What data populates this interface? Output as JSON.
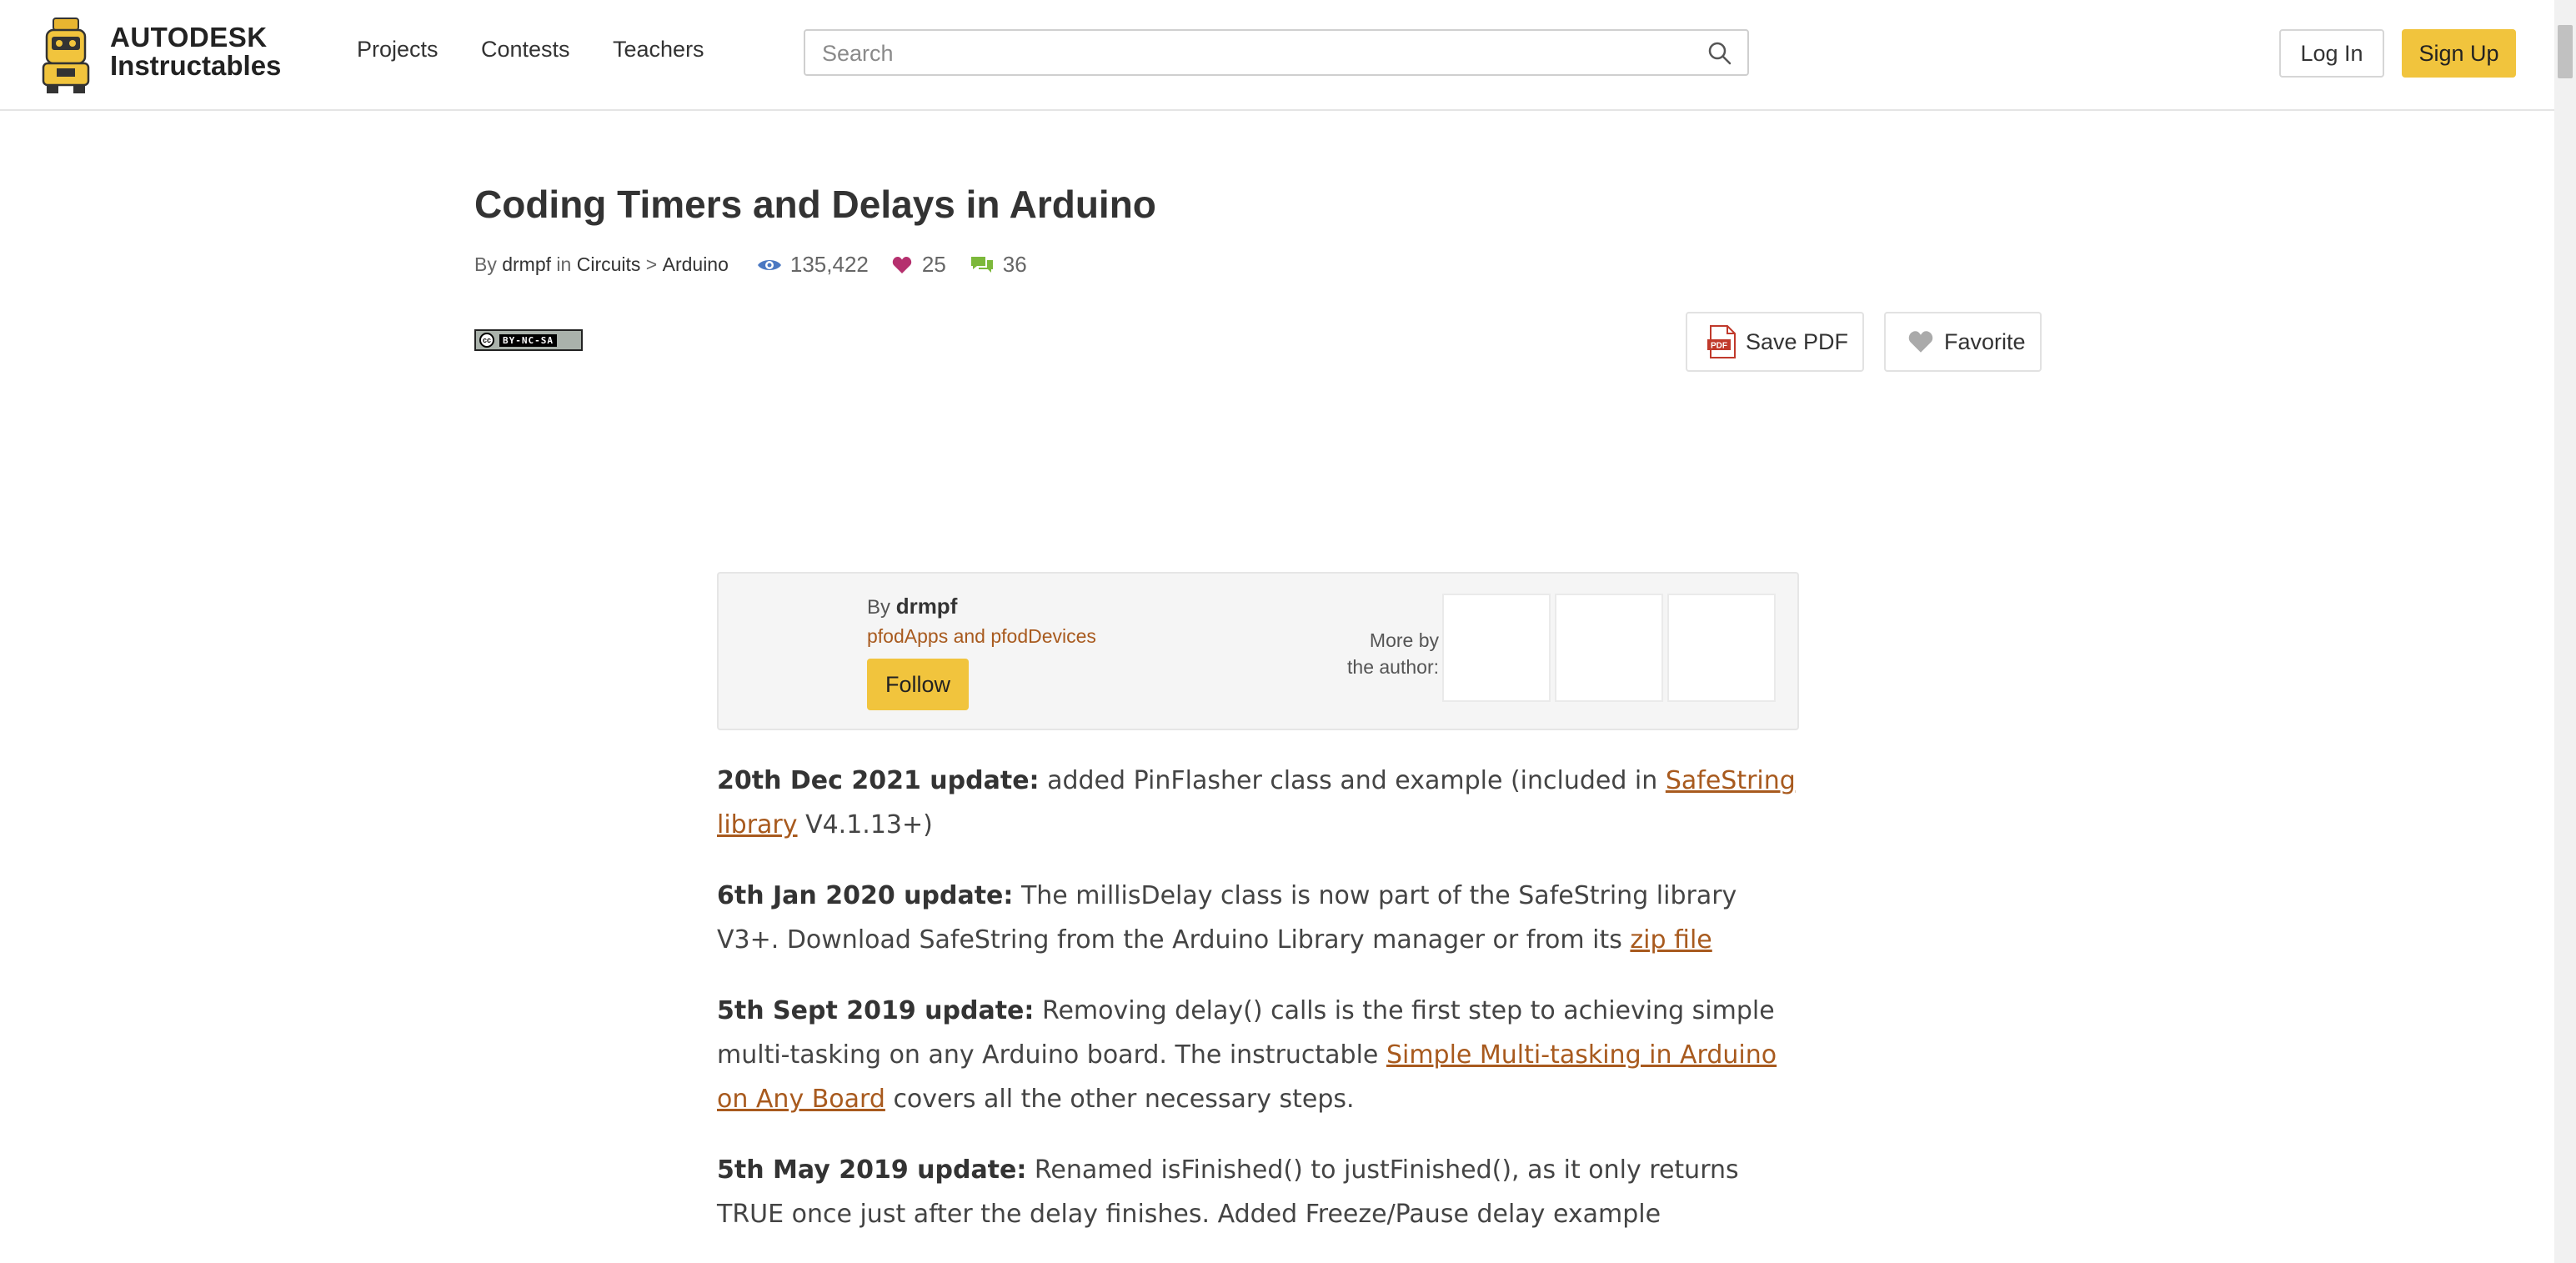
{
  "header": {
    "logo_line1": "AUTODESK",
    "logo_line2": "Instructables",
    "nav": [
      "Projects",
      "Contests",
      "Teachers"
    ],
    "search_placeholder": "Search",
    "login_label": "Log In",
    "signup_label": "Sign Up"
  },
  "article": {
    "title": "Coding Timers and Delays in Arduino",
    "by_label": "By",
    "author": "drmpf",
    "in_label": "in",
    "category": "Circuits",
    "separator": ">",
    "subcategory": "Arduino",
    "views": "135,422",
    "favorites": "25",
    "comments": "36",
    "license_text": "BY-NC-SA",
    "save_pdf_label": "Save PDF",
    "favorite_label": "Favorite"
  },
  "author_box": {
    "by_label": "By",
    "author": "drmpf",
    "subtitle": "pfodApps and pfodDevices",
    "follow_label": "Follow",
    "more_by_line1": "More by",
    "more_by_line2": "the author:"
  },
  "updates": [
    {
      "date": "20th Dec 2021 update:",
      "text1": " added PinFlasher class and example (included in ",
      "link": "SafeString library",
      "text2": " V4.1.13+)"
    },
    {
      "date": "6th Jan 2020 update:",
      "text1": " The millisDelay class is now part of the SafeString library V3+. Download SafeString from the Arduino Library manager or from its ",
      "link": "zip file",
      "text2": ""
    },
    {
      "date": "5th Sept 2019 update:",
      "text1": " Removing delay() calls is the first step to achieving simple multi-tasking on any Arduino board. The instructable ",
      "link": "Simple Multi-tasking in Arduino on Any Board",
      "text2": " covers all the other necessary steps."
    },
    {
      "date": "5th May 2019 update:",
      "text1": " Renamed isFinished() to justFinished(), as it only returns TRUE once just after the delay finishes. Added Freeze/Pause delay example",
      "link": "",
      "text2": ""
    }
  ],
  "colors": {
    "accent_yellow": "#f1c43d",
    "link_orange": "#a85a1e",
    "views_icon": "#4a78c2",
    "heart_icon": "#b5306e",
    "comment_icon": "#7cb83a"
  },
  "icons": [
    "robot-logo-icon",
    "search-icon",
    "eye-icon",
    "heart-icon",
    "comment-icon",
    "pdf-icon",
    "heart-outline-icon"
  ]
}
